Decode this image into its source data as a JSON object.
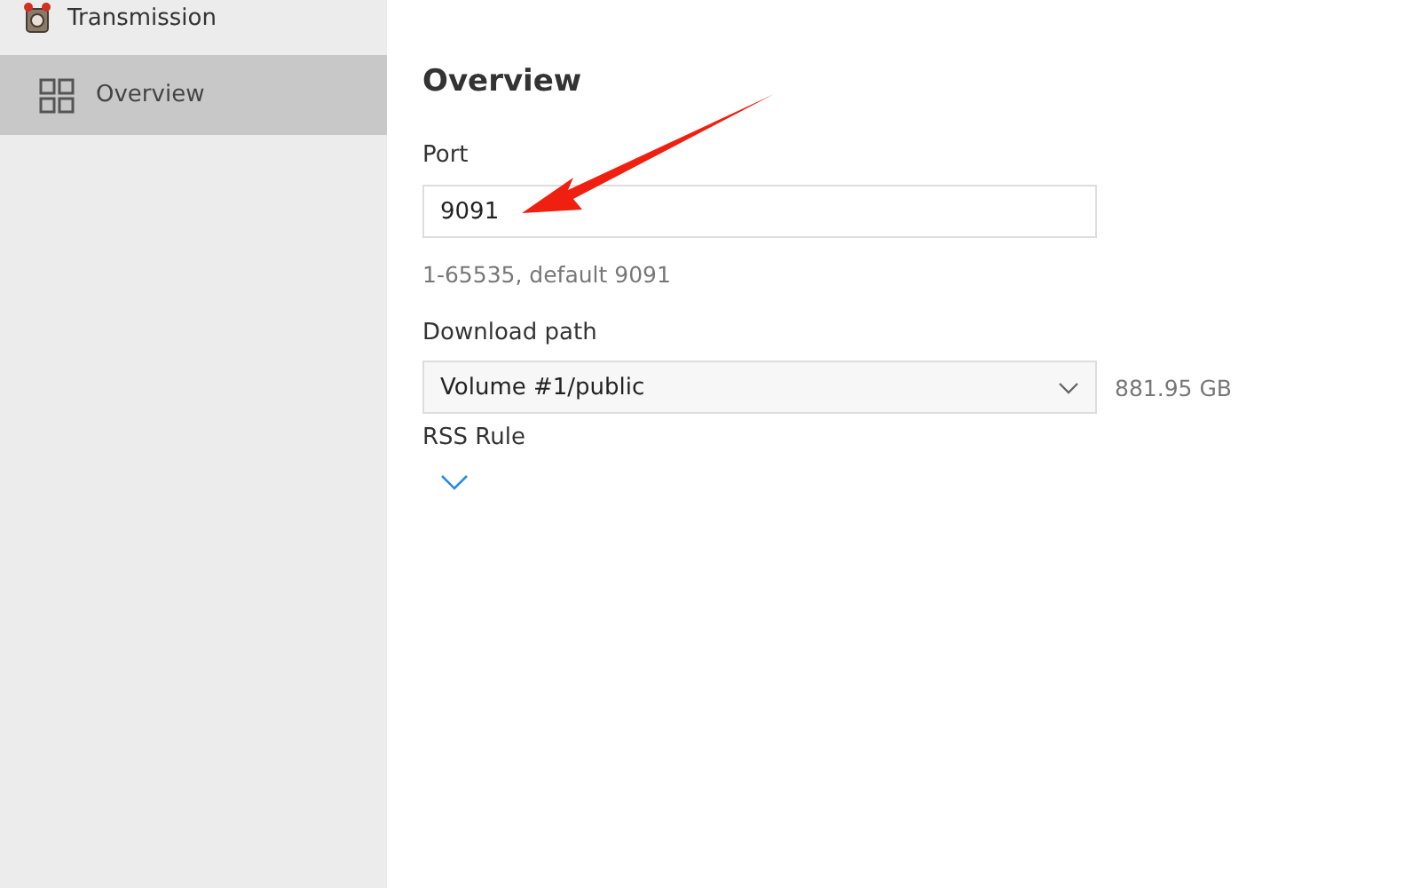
{
  "app": {
    "title": "Transmission"
  },
  "sidebar": {
    "items": [
      {
        "label": "Overview",
        "selected": true
      }
    ]
  },
  "main": {
    "title": "Overview",
    "port": {
      "label": "Port",
      "value": "9091",
      "hint": "1-65535, default 9091"
    },
    "download_path": {
      "label": "Download path",
      "value": "Volume #1/public",
      "free_space": "881.95 GB"
    },
    "rss_rule": {
      "label": "RSS Rule",
      "expanded": false
    }
  }
}
